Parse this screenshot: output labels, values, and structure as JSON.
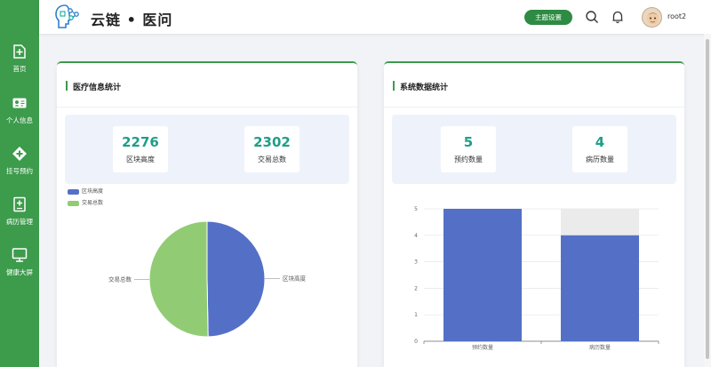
{
  "app": {
    "title": "云链 • 医问"
  },
  "header": {
    "theme_button": "主题设置",
    "username": "root2"
  },
  "sidebar": {
    "items": [
      {
        "label": "首页",
        "icon": "home-plus-icon"
      },
      {
        "label": "个人信息",
        "icon": "id-card-icon"
      },
      {
        "label": "挂号预约",
        "icon": "medical-cross-icon"
      },
      {
        "label": "病历管理",
        "icon": "medical-record-icon"
      },
      {
        "label": "健康大屏",
        "icon": "monitor-icon"
      }
    ]
  },
  "colors": {
    "sidebar": "#3d9b4c",
    "accent": "#2e8b43",
    "stat_value": "#1f9e88",
    "series_blue": "#5470c6",
    "series_green": "#91cc75"
  },
  "cards": {
    "medical": {
      "title": "医疗信息统计",
      "stats": [
        {
          "value": "2276",
          "label": "区块高度"
        },
        {
          "value": "2302",
          "label": "交易总数"
        }
      ]
    },
    "system": {
      "title": "系统数据统计",
      "stats": [
        {
          "value": "5",
          "label": "预约数量"
        },
        {
          "value": "4",
          "label": "病历数量"
        }
      ]
    }
  },
  "chart_data": [
    {
      "type": "pie",
      "labels": [
        "区块高度",
        "交易总数"
      ],
      "values": [
        2276,
        2302
      ],
      "legend": [
        "区块高度",
        "交易总数"
      ],
      "legend_position": "top-left"
    },
    {
      "type": "bar",
      "categories": [
        "预约数量",
        "病历数量"
      ],
      "values": [
        5,
        4
      ],
      "background_max": 5,
      "ylim": [
        0,
        5
      ],
      "yticks": [
        "0",
        "1",
        "2",
        "3",
        "4",
        "5"
      ],
      "grid": true
    }
  ]
}
